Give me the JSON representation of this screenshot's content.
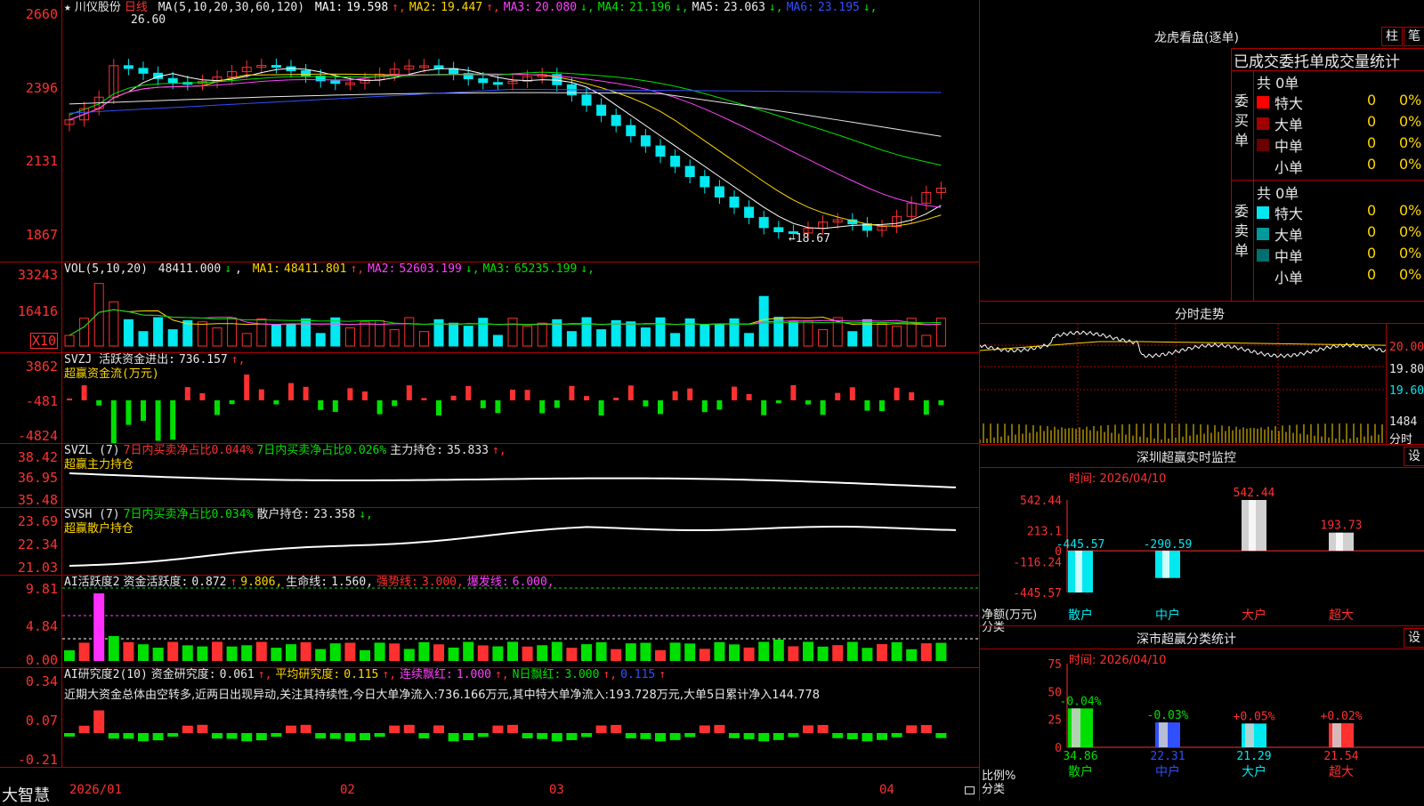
{
  "stock": {
    "star": "★",
    "name": "川仪股份",
    "period": "日线"
  },
  "kline": {
    "ma_header": "MA(5,10,20,30,60,120)",
    "ma": [
      {
        "label": "MA1:",
        "value": "19.598",
        "arrow": "↑",
        "color": "#ffffff"
      },
      {
        "label": "MA2:",
        "value": "19.447",
        "arrow": "↑",
        "color": "#ffd700"
      },
      {
        "label": "MA3:",
        "value": "20.080",
        "arrow": "↓",
        "color": "#ff40ff"
      },
      {
        "label": "MA4:",
        "value": "21.196",
        "arrow": "↓",
        "color": "#00e000"
      },
      {
        "label": "MA5:",
        "value": "23.063",
        "arrow": "↓",
        "color": "#e8e8e8"
      },
      {
        "label": "MA6:",
        "value": "23.195",
        "arrow": "↓",
        "color": "#3050ff"
      }
    ],
    "y_ticks": [
      "2660",
      "2396",
      "2131",
      "1867"
    ],
    "high_label": "26.60",
    "low_label": "←18.67"
  },
  "vol": {
    "header": "VOL(5,10,20)",
    "value": "48411.000",
    "value_arrow": "↓",
    "ma": [
      {
        "label": "MA1:",
        "value": "48411.801",
        "arrow": "↑",
        "color": "#ffd700"
      },
      {
        "label": "MA2:",
        "value": "52603.199",
        "arrow": "↓",
        "color": "#ff40ff"
      },
      {
        "label": "MA3:",
        "value": "65235.199",
        "arrow": "↓",
        "color": "#00e000"
      }
    ],
    "y_ticks": [
      "33243",
      "16416"
    ],
    "unit": "X10"
  },
  "svzj": {
    "header": "SVZJ  活跃资金进出:",
    "value": "736.157",
    "arrow": "↑,",
    "sub": "超赢资金流(万元)",
    "y_ticks": [
      "3862",
      "-481",
      "-4824"
    ]
  },
  "svzl": {
    "header": "SVZL (7)",
    "t1": "7日内买卖净占比0.044%",
    "t2": "7日内买卖净占比0.026%",
    "t3": "主力持仓:",
    "value": "35.833",
    "arrow": "↑,",
    "sub": "超赢主力持仓",
    "y_ticks": [
      "38.42",
      "36.95",
      "35.48"
    ]
  },
  "svsh": {
    "header": "SVSH (7)",
    "t1": "7日内买卖净占比0.034%",
    "t3": "散户持仓:",
    "value": "23.358",
    "arrow": "↓,",
    "sub": "超赢散户持仓",
    "y_ticks": [
      "23.69",
      "22.34",
      "21.03"
    ]
  },
  "ai_active": {
    "header": "AI活跃度2",
    "t1": "资金活跃度:",
    "v1": "0.872",
    "a1": "↑",
    "v2": "9.806,",
    "t2": "生命线:",
    "v3": "1.560,",
    "t3": "强势线:",
    "v4": "3.000,",
    "t4": "爆发线:",
    "v5": "6.000,",
    "y_ticks": [
      "9.81",
      "4.84",
      "0.00"
    ]
  },
  "ai_research": {
    "header": "AI研究度2(10)",
    "t1": "资金研究度:",
    "v1": "0.061",
    "a1": "↑,",
    "t2": "平均研究度:",
    "v2": "0.115",
    "a2": "↑,",
    "t3": "连续飘红:",
    "v3": "1.000",
    "a3": "↑,",
    "t4": "N日飘红:",
    "v4": "3.000",
    "a4": "↑,",
    "v5": "0.115",
    "a5": "↑",
    "note": "近期大资金总体由空转多,近两日出现异动,关注其持续性,今日大单净流入:736.166万元,其中特大单净流入:193.728万元,大单5日累计净入144.778",
    "y_ticks": [
      "0.34",
      "0.07",
      "-0.21"
    ]
  },
  "xaxis": {
    "brand": "大智慧",
    "labels": [
      "2026/01",
      "02",
      "03",
      "04"
    ]
  },
  "dragon": {
    "title": "龙虎看盘(逐单)",
    "btn1": "柱",
    "btn2": "笔",
    "subtitle": "已成交委托单成交量统计",
    "buy": {
      "side": "委买单",
      "total": "共 0单",
      "rows": [
        {
          "label": "特大",
          "n": "0",
          "pct": "0%",
          "color": "#ff0000"
        },
        {
          "label": "大单",
          "n": "0",
          "pct": "0%",
          "color": "#a00000"
        },
        {
          "label": "中单",
          "n": "0",
          "pct": "0%",
          "color": "#6a0000"
        },
        {
          "label": "小单",
          "n": "0",
          "pct": "0%",
          "color": "#000000"
        }
      ]
    },
    "sell": {
      "side": "委卖单",
      "total": "共 0单",
      "rows": [
        {
          "label": "特大",
          "n": "0",
          "pct": "0%",
          "color": "#00e8f0"
        },
        {
          "label": "大单",
          "n": "0",
          "pct": "0%",
          "color": "#009a9a"
        },
        {
          "label": "中单",
          "n": "0",
          "pct": "0%",
          "color": "#007070"
        },
        {
          "label": "小单",
          "n": "0",
          "pct": "0%",
          "color": "#000000"
        }
      ]
    }
  },
  "intraday": {
    "title": "分时走势",
    "y_ticks": [
      "20.00",
      "19.80",
      "19.60"
    ],
    "vol_tick": "1484",
    "vol_unit": "分时"
  },
  "sz_monitor": {
    "title": "深圳超赢实时监控",
    "btn": "设",
    "time": "时间: 2026/04/10",
    "y_ticks": [
      "542.44",
      "213.1",
      "0",
      "-116.24",
      "-445.57"
    ],
    "ylabel": "净额(万元)",
    "xlabel": "分类",
    "chart_data": {
      "type": "bar",
      "categories": [
        "散户",
        "中户",
        "大户",
        "超大"
      ],
      "values": [
        -445.57,
        -290.59,
        542.44,
        193.73
      ],
      "ylim": [
        -445.57,
        542.44
      ]
    },
    "labels": [
      "-445.57",
      "-290.59",
      "542.44",
      "193.73"
    ]
  },
  "sz_class": {
    "title": "深市超赢分类统计",
    "btn": "设",
    "time": "时间: 2026/04/10",
    "y_ticks": [
      "75",
      "50",
      "25",
      "0"
    ],
    "ylabel": "比例%",
    "xlabel": "分类",
    "chart_data": {
      "type": "bar",
      "categories": [
        "散户",
        "中户",
        "大户",
        "超大"
      ],
      "values": [
        34.86,
        22.31,
        21.29,
        21.54
      ],
      "change": [
        "-0.04%",
        "-0.03%",
        "+0.05%",
        "+0.02%"
      ],
      "ylim": [
        0,
        75
      ]
    },
    "colors": [
      "#00e000",
      "#3050ff",
      "#00e8f0",
      "#ff3030"
    ]
  },
  "colors": {
    "up": "#ff3030",
    "down": "#00e8f0",
    "grid": "#b00000"
  }
}
